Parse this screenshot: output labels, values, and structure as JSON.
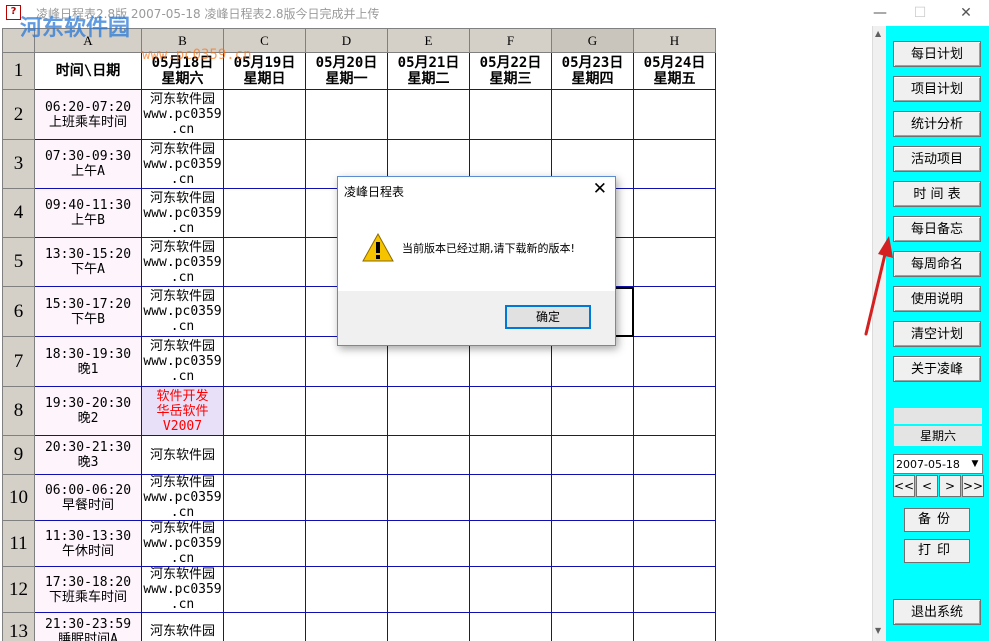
{
  "window": {
    "title": "凌峰日程表2.8版     2007-05-18     凌峰日程表2.8版今日完成并上传",
    "min_glyph": "—",
    "max_glyph": "☐",
    "close_glyph": "✕",
    "app_glyph": "?"
  },
  "watermark": {
    "logo_text": "河东软件园",
    "url": "www.pc0359.cn"
  },
  "grid": {
    "columns": [
      "A",
      "B",
      "C",
      "D",
      "E",
      "F",
      "G",
      "H"
    ],
    "row_numbers": [
      "1",
      "2",
      "3",
      "4",
      "5",
      "6",
      "7",
      "8",
      "9",
      "10",
      "11",
      "12",
      "13"
    ],
    "header_row": [
      "时间\\日期",
      "05月18日\n星期六",
      "05月19日\n星期日",
      "05月20日\n星期一",
      "05月21日\n星期二",
      "05月22日\n星期三",
      "05月23日\n星期四",
      "05月24日\n星期五"
    ],
    "time_slots": [
      "06:20-07:20\n上班乘车时间",
      "07:30-09:30\n上午A",
      "09:40-11:30\n上午B",
      "13:30-15:20\n下午A",
      "15:30-17:20\n下午B",
      "18:30-19:30\n晚1",
      "19:30-20:30\n晚2",
      "20:30-21:30\n晚3",
      "06:00-06:20\n早餐时间",
      "11:30-13:30\n午休时间",
      "17:30-18:20\n下班乘车时间",
      "21:30-23:59\n睡眠时间A"
    ],
    "b_column": [
      "河东软件园\nwww.pc0359\n.cn",
      "河东软件园\nwww.pc0359\n.cn",
      "河东软件园\nwww.pc0359\n.cn",
      "河东软件园\nwww.pc0359\n.cn",
      "河东软件园\nwww.pc0359\n.cn",
      "河东软件园\nwww.pc0359\n.cn",
      "软件开发\n华岳软件\nV2007",
      "河东软件园",
      "河东软件园\nwww.pc0359\n.cn",
      "河东软件园\nwww.pc0359\n.cn",
      "河东软件园\nwww.pc0359\n.cn",
      "河东软件园"
    ]
  },
  "sidebar": {
    "buttons": [
      "每日计划",
      "项目计划",
      "统计分析",
      "活动项目",
      "时 间 表",
      "每日备忘",
      "每周命名",
      "使用说明",
      "清空计划",
      "关于凌峰"
    ],
    "weekday": "星期六",
    "date_value": "2007-05-18",
    "nav": [
      "<<",
      "<",
      ">",
      ">>"
    ],
    "backup_label": "备份",
    "print_label": "打印",
    "exit_label": "退出系统"
  },
  "dialog": {
    "title": "凌峰日程表",
    "message": "当前版本已经过期,请下载新的版本!",
    "ok_label": "确定",
    "close_glyph": "✕"
  },
  "colors": {
    "sidebar_bg": "#00ffff",
    "grid_border": "#1010b0",
    "highlight_text": "#ff0000",
    "arrow": "#d42020"
  }
}
